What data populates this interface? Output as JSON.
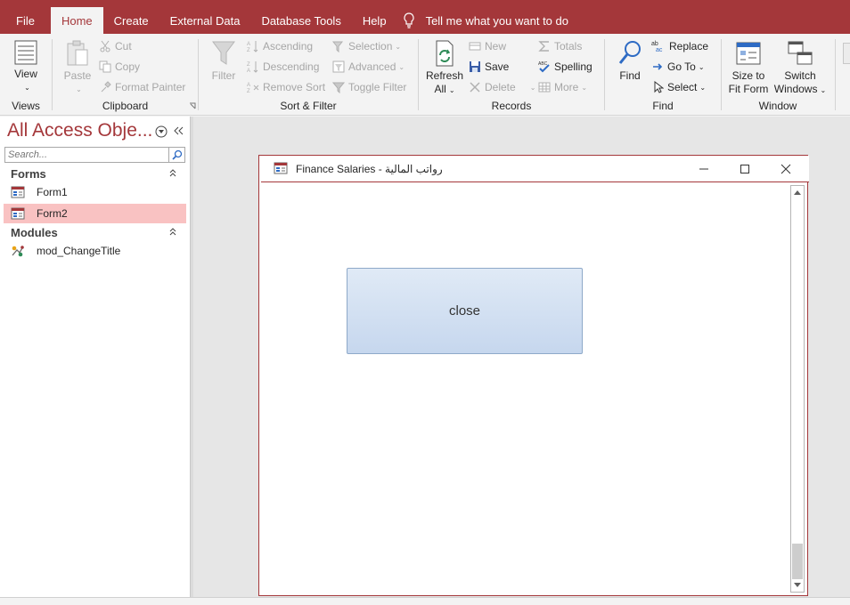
{
  "tabs": {
    "file": "File",
    "home": "Home",
    "create": "Create",
    "external_data": "External Data",
    "database_tools": "Database Tools",
    "help": "Help",
    "tell_me": "Tell me what you want to do"
  },
  "ribbon": {
    "views": {
      "label": "Views",
      "view": "View"
    },
    "clipboard": {
      "label": "Clipboard",
      "paste": "Paste",
      "cut": "Cut",
      "copy": "Copy",
      "format_painter": "Format Painter"
    },
    "sort_filter": {
      "label": "Sort & Filter",
      "filter": "Filter",
      "ascending": "Ascending",
      "descending": "Descending",
      "remove_sort": "Remove Sort",
      "selection": "Selection",
      "advanced": "Advanced",
      "toggle_filter": "Toggle Filter"
    },
    "records": {
      "label": "Records",
      "refresh_line1": "Refresh",
      "refresh_line2": "All",
      "new": "New",
      "save": "Save",
      "delete": "Delete",
      "totals": "Totals",
      "spelling": "Spelling",
      "more": "More"
    },
    "find": {
      "label": "Find",
      "find": "Find",
      "replace": "Replace",
      "go_to": "Go To",
      "select": "Select"
    },
    "window": {
      "label": "Window",
      "size_line1": "Size to",
      "size_line2": "Fit Form",
      "switch_line1": "Switch",
      "switch_line2": "Windows"
    }
  },
  "nav": {
    "title": "All Access Obje...",
    "search_placeholder": "Search...",
    "sections": [
      {
        "name": "Forms",
        "items": [
          "Form1",
          "Form2"
        ]
      },
      {
        "name": "Modules",
        "items": [
          "mod_ChangeTitle"
        ]
      }
    ],
    "selected_item": "Form2"
  },
  "form_window": {
    "title": "Finance Salaries - رواتب المالية",
    "button_label": "close"
  },
  "colors": {
    "accent": "#a4373a",
    "selection": "#f9c2c2"
  }
}
